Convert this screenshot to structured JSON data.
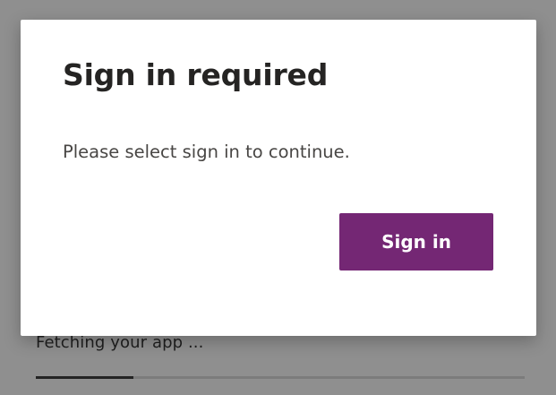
{
  "loading": {
    "text": "Fetching your app ...",
    "progress_fraction": 0.2
  },
  "dialog": {
    "title": "Sign in required",
    "message": "Please select sign in to continue.",
    "signin_label": "Sign in"
  },
  "colors": {
    "overlay": "#8f8f8f",
    "button_background": "#742774",
    "button_text": "#ffffff",
    "progress_fill": "#232323"
  }
}
